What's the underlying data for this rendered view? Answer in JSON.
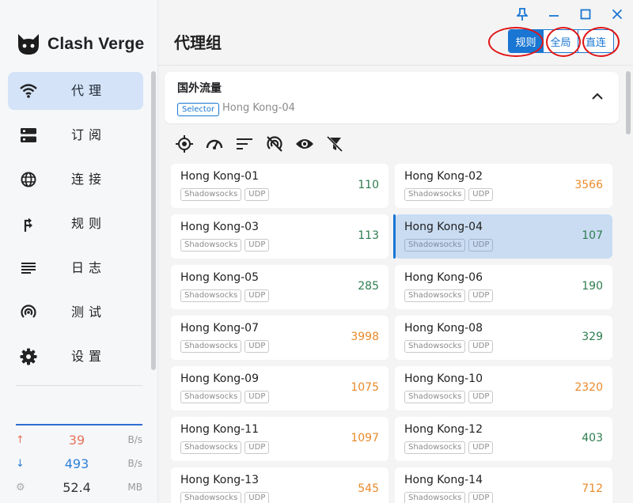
{
  "app": {
    "name": "Clash Verge"
  },
  "window_controls": [
    {
      "name": "pin-icon",
      "glyph": "pin"
    },
    {
      "name": "minimize-icon",
      "glyph": "minus"
    },
    {
      "name": "maximize-icon",
      "glyph": "square"
    },
    {
      "name": "close-icon",
      "glyph": "x"
    }
  ],
  "sidebar": {
    "items": [
      {
        "label": "代理",
        "icon": "wifi-icon",
        "active": true
      },
      {
        "label": "订阅",
        "icon": "storage-icon",
        "active": false
      },
      {
        "label": "连接",
        "icon": "globe-icon",
        "active": false
      },
      {
        "label": "规则",
        "icon": "fork-right-icon",
        "active": false
      },
      {
        "label": "日志",
        "icon": "log-lines-icon",
        "active": false
      },
      {
        "label": "测试",
        "icon": "broadcast-icon",
        "active": false
      },
      {
        "label": "设置",
        "icon": "gear-icon",
        "active": false
      }
    ]
  },
  "traffic": {
    "upload": {
      "value": "39",
      "unit": "B/s",
      "color": "#e5735b"
    },
    "download": {
      "value": "493",
      "unit": "B/s",
      "color": "#2f80d8"
    },
    "memory": {
      "value": "52.4",
      "unit": "MB",
      "color": "#333333"
    }
  },
  "header": {
    "title": "代理组",
    "modes": [
      {
        "label": "规则",
        "active": true
      },
      {
        "label": "全局",
        "active": false
      },
      {
        "label": "直连",
        "active": false
      }
    ]
  },
  "group": {
    "name": "国外流量",
    "type": "Selector",
    "now": "Hong Kong-04"
  },
  "toolbar": [
    {
      "name": "locate-icon"
    },
    {
      "name": "speed-test-icon"
    },
    {
      "name": "sort-icon"
    },
    {
      "name": "url-off-icon"
    },
    {
      "name": "visibility-icon"
    },
    {
      "name": "filter-off-icon"
    }
  ],
  "proxies": [
    {
      "name": "Hong Kong-01",
      "tags": [
        "Shadowsocks",
        "UDP"
      ],
      "delay": "110",
      "status": "good"
    },
    {
      "name": "Hong Kong-02",
      "tags": [
        "Shadowsocks",
        "UDP"
      ],
      "delay": "3566",
      "status": "slow"
    },
    {
      "name": "Hong Kong-03",
      "tags": [
        "Shadowsocks",
        "UDP"
      ],
      "delay": "113",
      "status": "good"
    },
    {
      "name": "Hong Kong-04",
      "tags": [
        "Shadowsocks",
        "UDP"
      ],
      "delay": "107",
      "status": "good",
      "selected": true
    },
    {
      "name": "Hong Kong-05",
      "tags": [
        "Shadowsocks",
        "UDP"
      ],
      "delay": "285",
      "status": "good"
    },
    {
      "name": "Hong Kong-06",
      "tags": [
        "Shadowsocks",
        "UDP"
      ],
      "delay": "190",
      "status": "good"
    },
    {
      "name": "Hong Kong-07",
      "tags": [
        "Shadowsocks",
        "UDP"
      ],
      "delay": "3998",
      "status": "slow"
    },
    {
      "name": "Hong Kong-08",
      "tags": [
        "Shadowsocks",
        "UDP"
      ],
      "delay": "329",
      "status": "good"
    },
    {
      "name": "Hong Kong-09",
      "tags": [
        "Shadowsocks",
        "UDP"
      ],
      "delay": "1075",
      "status": "slow"
    },
    {
      "name": "Hong Kong-10",
      "tags": [
        "Shadowsocks",
        "UDP"
      ],
      "delay": "2320",
      "status": "slow"
    },
    {
      "name": "Hong Kong-11",
      "tags": [
        "Shadowsocks",
        "UDP"
      ],
      "delay": "1097",
      "status": "slow"
    },
    {
      "name": "Hong Kong-12",
      "tags": [
        "Shadowsocks",
        "UDP"
      ],
      "delay": "403",
      "status": "good"
    },
    {
      "name": "Hong Kong-13",
      "tags": [
        "Shadowsocks",
        "UDP"
      ],
      "delay": "545",
      "status": "slow"
    },
    {
      "name": "Hong Kong-14",
      "tags": [
        "Shadowsocks",
        "UDP"
      ],
      "delay": "712",
      "status": "slow"
    }
  ],
  "colors": {
    "accent": "#1976d2",
    "delay_good": "#2e7d4f",
    "delay_slow": "#ea8a2a",
    "annotation": "#e01414"
  }
}
